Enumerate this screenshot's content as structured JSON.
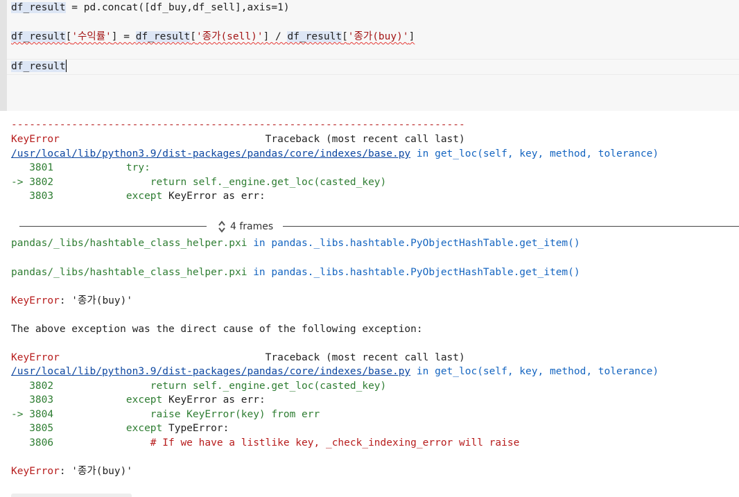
{
  "code": {
    "line1": {
      "var": "df_result",
      "rest": " = pd.concat([df_buy,df_sell],axis=1)"
    },
    "line2": {
      "var": "df_result",
      "p1": "[",
      "s1": "'수익률'",
      "p2": "] = ",
      "v2": "df_result",
      "p3": "[",
      "s2": "'종가(sell)'",
      "p4": "] / ",
      "v3": "df_result",
      "p5": "[",
      "s3": "'종가(buy)'",
      "p6": "]"
    },
    "line3": {
      "var": "df_result"
    }
  },
  "output": {
    "dashes": "---------------------------------------------------------------------------",
    "tb1": {
      "error": "KeyError",
      "traceback": "                                  Traceback (most recent call last)",
      "path": "/usr/local/lib/python3.9/dist-packages/pandas/core/indexes/base.py",
      "in": " in ",
      "func": "get_loc",
      "args": "(self, key, method, tolerance)",
      "lines": [
        {
          "num": "   3801",
          "pre": "            ",
          "kw": "try",
          "rest": ":"
        },
        {
          "num": "-> 3802",
          "pre": "                ",
          "kw": "",
          "rest": "return self._engine.get_loc(casted_key)"
        },
        {
          "num": "   3803",
          "pre": "            ",
          "kw": "except",
          "rest": " KeyError as err:"
        }
      ]
    },
    "frames_label": "4 frames",
    "helper1": {
      "file": "pandas/_libs/hashtable_class_helper.pxi",
      "in": " in ",
      "func": "pandas._libs.hashtable.PyObjectHashTable.get_item()"
    },
    "helper2": {
      "file": "pandas/_libs/hashtable_class_helper.pxi",
      "in": " in ",
      "func": "pandas._libs.hashtable.PyObjectHashTable.get_item()"
    },
    "keyerror1": {
      "name": "KeyError",
      "msg": ": '종가(buy)'"
    },
    "cause": "The above exception was the direct cause of the following exception:",
    "tb2": {
      "error": "KeyError",
      "traceback": "                                  Traceback (most recent call last)",
      "path": "/usr/local/lib/python3.9/dist-packages/pandas/core/indexes/base.py",
      "in": " in ",
      "func": "get_loc",
      "args": "(self, key, method, tolerance)",
      "lines": [
        {
          "num": "   3802",
          "pre": "                ",
          "kw": "",
          "rest": "return self._engine.get_loc(casted_key)"
        },
        {
          "num": "   3803",
          "pre": "            ",
          "kw": "except",
          "rest": " KeyError as err:"
        },
        {
          "num": "-> 3804",
          "pre": "                ",
          "kw": "",
          "rest": "raise KeyError(key) from err"
        },
        {
          "num": "   3805",
          "pre": "            ",
          "kw": "except",
          "rest": " TypeError:"
        },
        {
          "num": "   3806",
          "pre": "                ",
          "kw": "",
          "rest": "# If we have a listlike key, _check_indexing_error will raise"
        }
      ]
    },
    "keyerror2": {
      "name": "KeyError",
      "msg": ": '종가(buy)'"
    }
  }
}
